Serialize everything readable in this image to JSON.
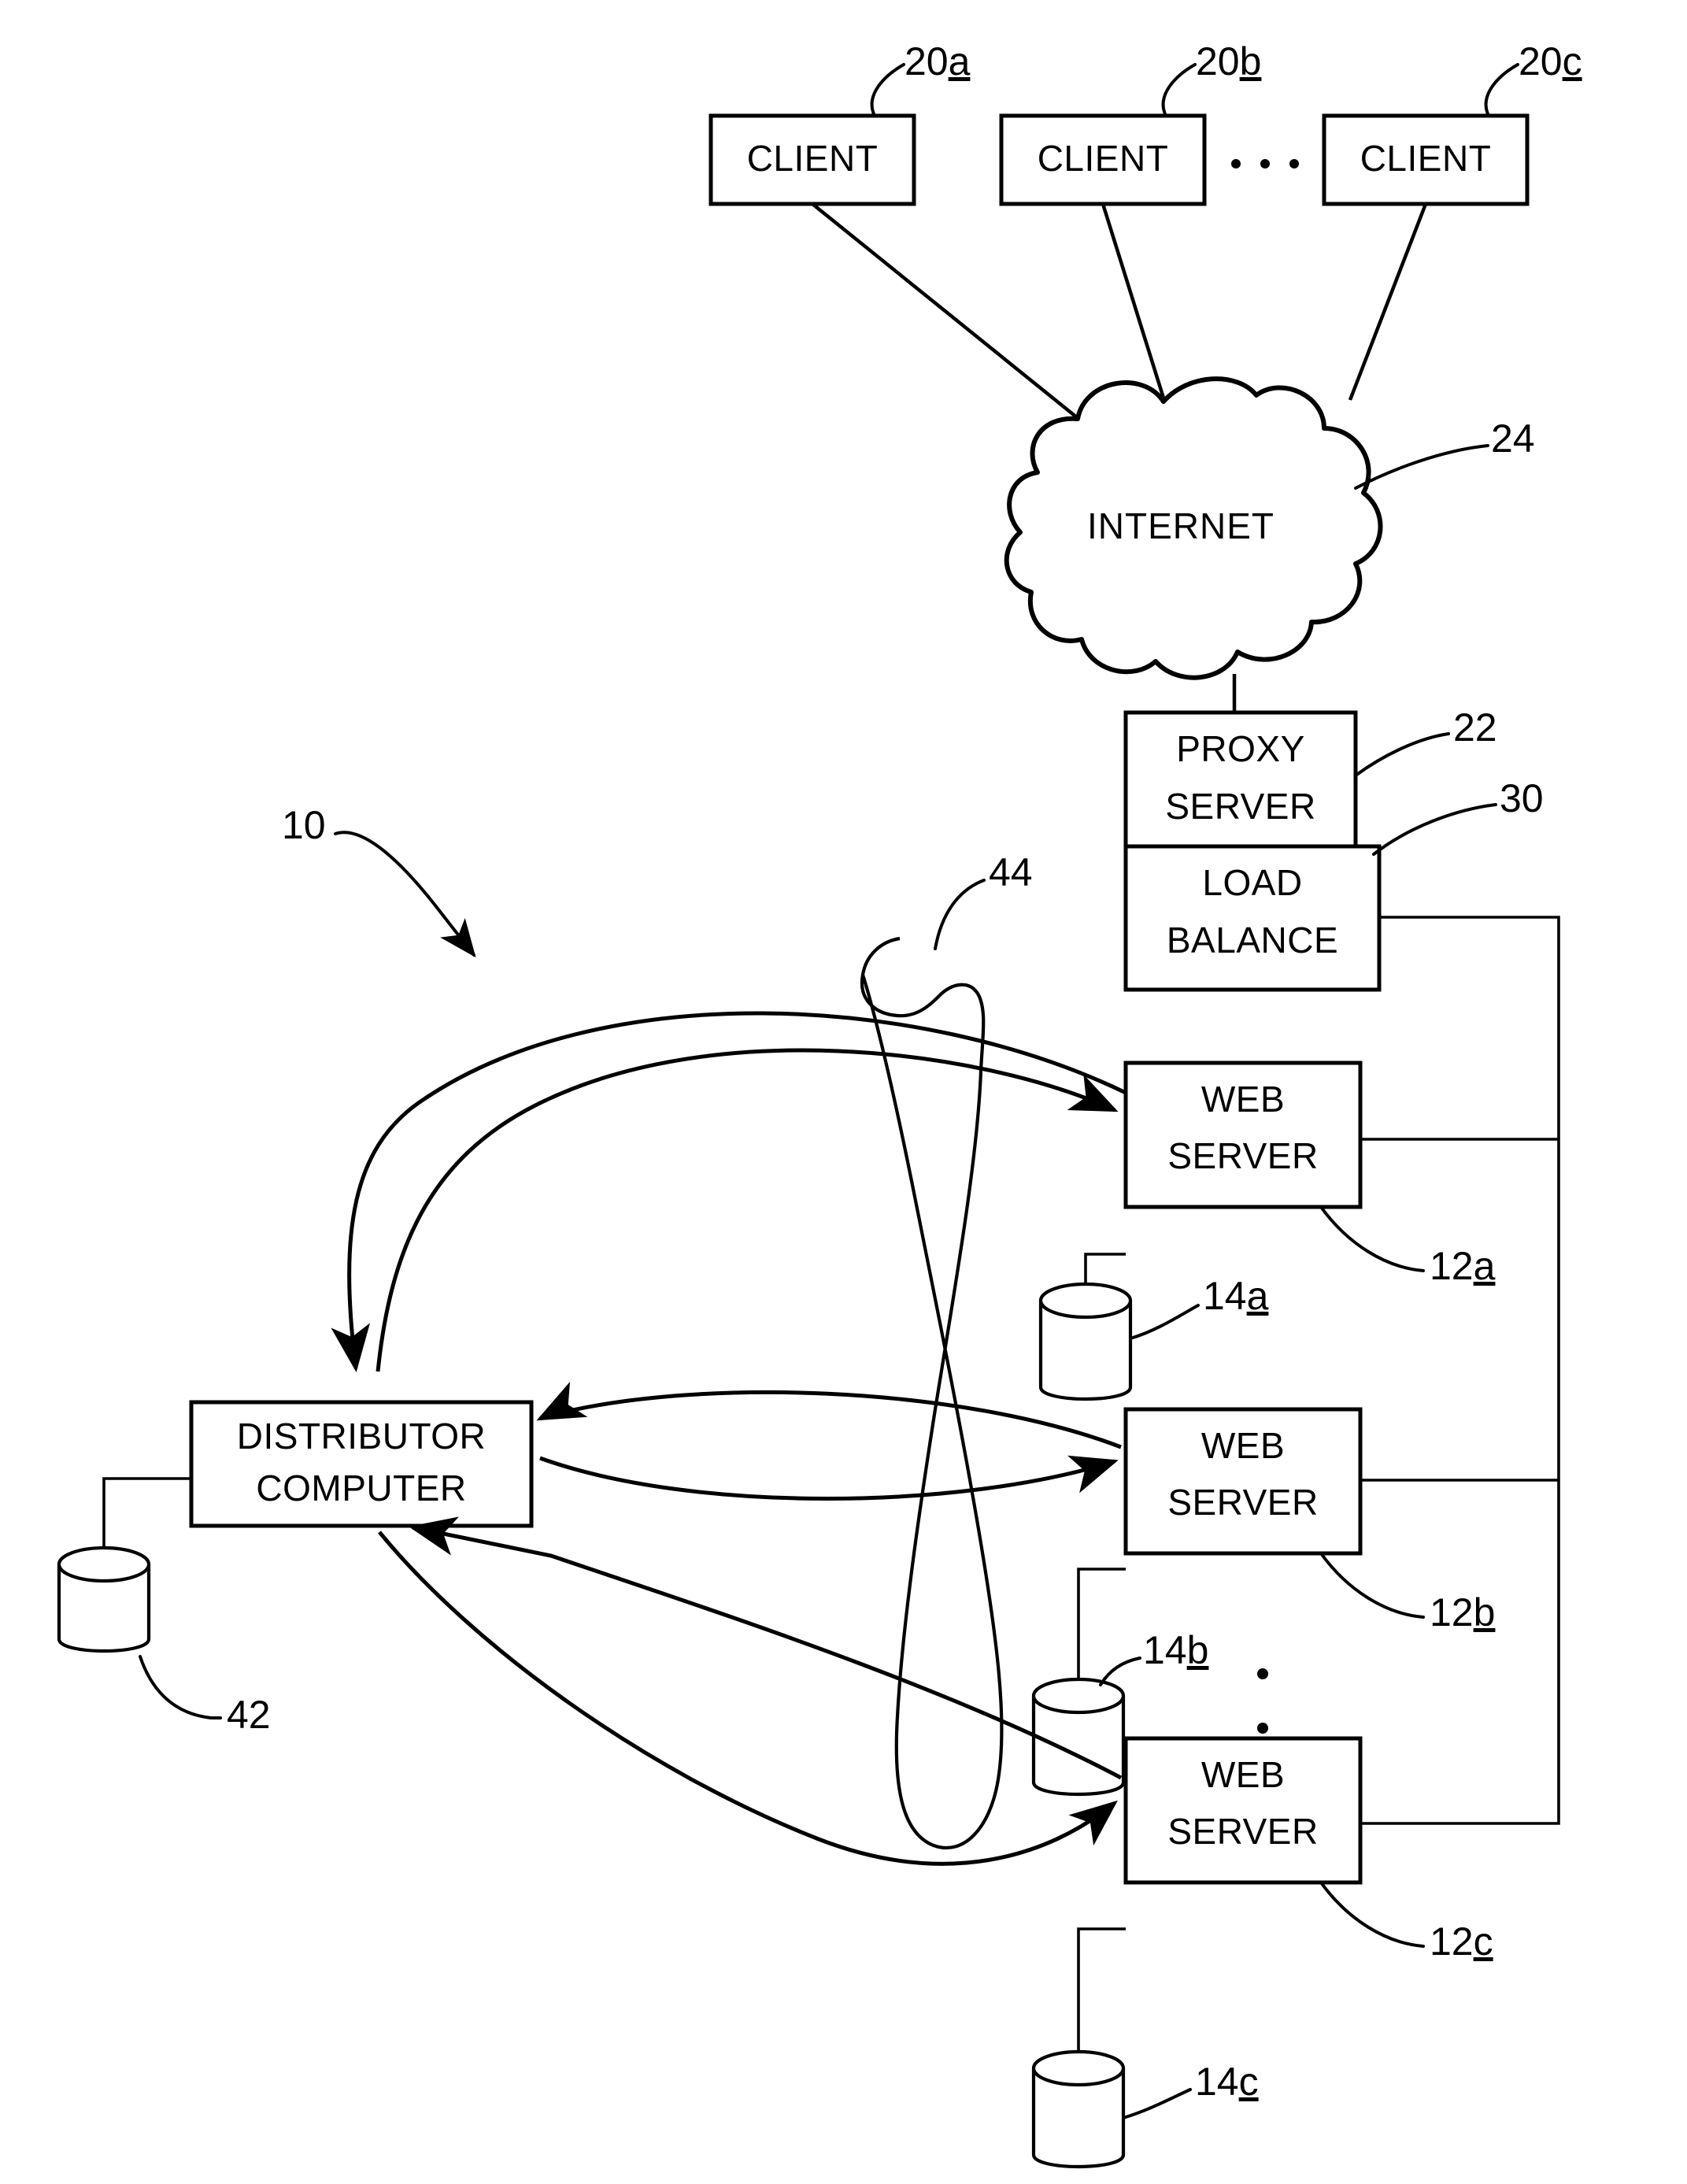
{
  "figure": {
    "type": "patent-network-architecture-diagram",
    "system_reference": "10"
  },
  "nodes": {
    "clients": [
      {
        "label": "CLIENT",
        "ref_num": "20",
        "ref_sub": "a"
      },
      {
        "label": "CLIENT",
        "ref_num": "20",
        "ref_sub": "b"
      },
      {
        "label": "CLIENT",
        "ref_num": "20",
        "ref_sub": "c"
      }
    ],
    "client_ellipsis": "· · ·",
    "internet": {
      "label": "INTERNET",
      "ref_num": "24",
      "ref_sub": ""
    },
    "proxy_server": {
      "line1": "PROXY",
      "line2": "SERVER",
      "ref_num": "22",
      "ref_sub": ""
    },
    "load_balance": {
      "line1": "LOAD",
      "line2": "BALANCE",
      "ref_num": "30",
      "ref_sub": ""
    },
    "web_servers": [
      {
        "line1": "WEB",
        "line2": "SERVER",
        "ref_num": "12",
        "ref_sub": "a"
      },
      {
        "line1": "WEB",
        "line2": "SERVER",
        "ref_num": "12",
        "ref_sub": "b"
      },
      {
        "line1": "WEB",
        "line2": "SERVER",
        "ref_num": "12",
        "ref_sub": "c"
      }
    ],
    "web_databases": [
      {
        "ref_num": "14",
        "ref_sub": "a"
      },
      {
        "ref_num": "14",
        "ref_sub": "b"
      },
      {
        "ref_num": "14",
        "ref_sub": "c"
      }
    ],
    "distributor": {
      "line1": "DISTRIBUTOR",
      "line2": "COMPUTER",
      "ref_num": "",
      "ref_sub": ""
    },
    "distributor_database": {
      "ref_num": "42",
      "ref_sub": ""
    },
    "communication_envelope": {
      "ref_num": "44",
      "ref_sub": ""
    }
  },
  "colors": {
    "ink": "#000000",
    "paper": "#ffffff"
  }
}
